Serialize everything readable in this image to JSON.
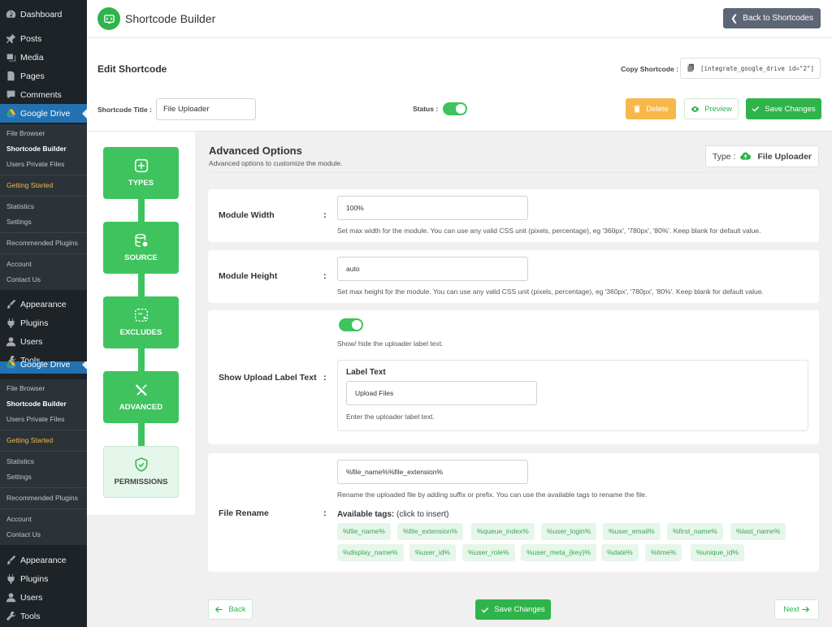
{
  "wp_menu": {
    "top": [
      {
        "label": "Dashboard",
        "icon": "dashboard-icon"
      },
      {
        "label": "Posts",
        "icon": "pin-icon"
      },
      {
        "label": "Media",
        "icon": "media-icon"
      },
      {
        "label": "Pages",
        "icon": "page-icon"
      },
      {
        "label": "Comments",
        "icon": "comment-icon"
      },
      {
        "label": "Google Drive",
        "icon": "google-drive-icon"
      }
    ],
    "submenu": [
      "File Browser",
      "Shortcode Builder",
      "Users Private Files",
      "Getting Started",
      "Statistics",
      "Settings",
      "Recommended Plugins",
      "Account",
      "Contact Us"
    ],
    "bottom": [
      {
        "label": "Appearance",
        "icon": "brush-icon"
      },
      {
        "label": "Plugins",
        "icon": "plug-icon"
      },
      {
        "label": "Users",
        "icon": "user-icon"
      },
      {
        "label": "Tools",
        "icon": "wrench-icon"
      }
    ]
  },
  "header": {
    "title": "Shortcode Builder",
    "back_label": "Back to Shortcodes"
  },
  "edit": {
    "title": "Edit Shortcode",
    "copy_label": "Copy Shortcode :",
    "shortcode": "[integrate_google_drive id=\"2\"]",
    "title_label": "Shortcode Title :",
    "title_value": "File Uploader",
    "status_label": "Status :",
    "status_on": true,
    "delete_label": "Delete",
    "preview_label": "Preview",
    "save_label": "Save Changes"
  },
  "steps": [
    {
      "label": "TYPES",
      "icon": "grid-plus-icon",
      "active": true
    },
    {
      "label": "SOURCE",
      "icon": "database-icon",
      "active": true
    },
    {
      "label": "EXCLUDES",
      "icon": "filter-x-icon",
      "active": true
    },
    {
      "label": "ADVANCED",
      "icon": "tools-icon",
      "active": true
    },
    {
      "label": "PERMISSIONS",
      "icon": "shield-check-icon",
      "active": false
    }
  ],
  "section": {
    "title": "Advanced Options",
    "subtitle": "Advanced options to customize the module.",
    "type_label": "Type :",
    "type_value": "File Uploader"
  },
  "options": {
    "module_width": {
      "label": "Module Width",
      "value": "100%",
      "help": "Set max width for the module. You can use any valid CSS unit (pixels, percentage), eg '360px', '780px', '80%'. Keep blank for default value."
    },
    "module_height": {
      "label": "Module Height",
      "value": "auto",
      "help": "Set max height for the module. You can use any valid CSS unit (pixels, percentage), eg '360px', '780px', '80%'. Keep blank for default value."
    },
    "upload_label": {
      "label": "Show Upload Label Text",
      "toggle_on": true,
      "toggle_help": "Show/ hide the uploader label text.",
      "inner_title": "Label Text",
      "value": "Upload Files",
      "help": "Enter the uploader label text."
    },
    "file_rename": {
      "label": "File Rename",
      "value": "%file_name%%file_extension%",
      "help": "Rename the uploaded file by adding suffix or prefix. You can use the available tags to rename the file.",
      "tags_label": "Available tags:",
      "tags_hint": "(click to insert)",
      "tags": [
        "%file_name%",
        "%file_extension%",
        "%queue_index%",
        "%user_login%",
        "%user_email%",
        "%first_name%",
        "%last_name%",
        "%display_name%",
        "%user_id%",
        "%user_role%",
        "%user_meta_{key}%",
        "%date%",
        "%time%",
        "%unique_id%"
      ]
    }
  },
  "footer": {
    "back_label": "Back",
    "save_label": "Save Changes",
    "next_label": "Next"
  },
  "colors": {
    "brand_green": "#2fb44b",
    "delete_orange": "#f7b84b",
    "wp_sidebar": "#1d2327",
    "wp_active": "#2271b1"
  }
}
